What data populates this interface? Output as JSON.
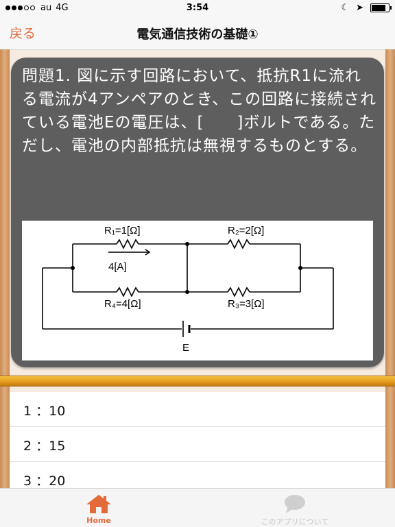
{
  "status_bar": {
    "carrier": "au",
    "network": "4G",
    "time": "3:54"
  },
  "nav": {
    "back_label": "戻る",
    "title": "電気通信技術の基礎①"
  },
  "question": {
    "text": "問題1. 図に示す回路において、抵抗R1に流れる電流が4アンペアのとき、この回路に接続されている電池Eの電圧は、[　　]ボルトである。ただし、電池の内部抵抗は無視するものとする。"
  },
  "circuit": {
    "r1_label": "R₁=1[Ω]",
    "r2_label": "R₂=2[Ω]",
    "r4_label": "R₄=4[Ω]",
    "r3_label": "R₃=3[Ω]",
    "current_label": "4[A]",
    "battery_label": "E"
  },
  "answers": [
    {
      "label": "1 ：10"
    },
    {
      "label": "2 ：15"
    },
    {
      "label": "3 ：20"
    }
  ],
  "tabbar": {
    "home_label": "Home",
    "about_label": "このアプリについて"
  },
  "colors": {
    "accent": "#e46a3a",
    "card_bg": "#5e5e5e",
    "orange_bar": "#e49a1c"
  }
}
